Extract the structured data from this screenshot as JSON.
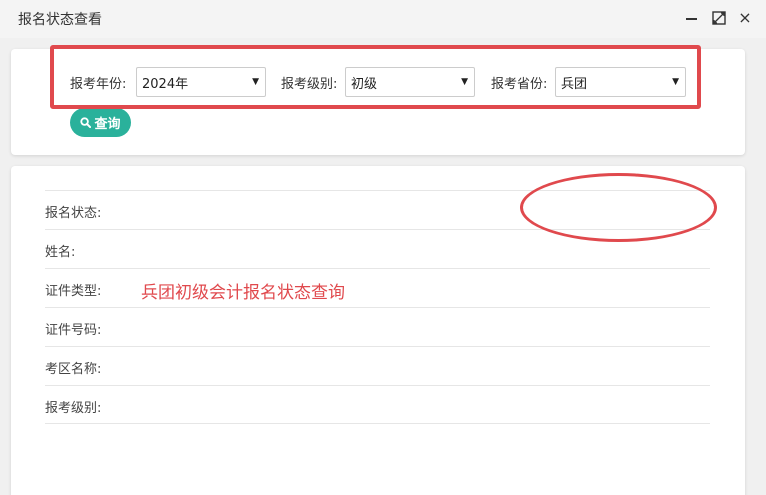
{
  "window": {
    "title": "报名状态查看",
    "buttons": [
      "minimize-icon",
      "maximize-icon",
      "close-icon"
    ],
    "close_glyph": "×"
  },
  "filters": {
    "year": {
      "label": "报考年份:",
      "value": "2024年"
    },
    "level": {
      "label": "报考级别:",
      "value": "初级"
    },
    "province": {
      "label": "报考省份:",
      "value": "兵团"
    },
    "query_button": "查询"
  },
  "info": {
    "rows": [
      {
        "label": "报名状态:"
      },
      {
        "label": "姓名:"
      },
      {
        "label": "证件类型:"
      },
      {
        "label": "证件号码:"
      },
      {
        "label": "考区名称:"
      },
      {
        "label": "报考级别:"
      }
    ]
  },
  "annotation": {
    "text": "兵团初级会计报名状态查询",
    "color": "#e0494d"
  },
  "colors": {
    "accent": "#2ab19b",
    "highlight": "#e0494d"
  }
}
